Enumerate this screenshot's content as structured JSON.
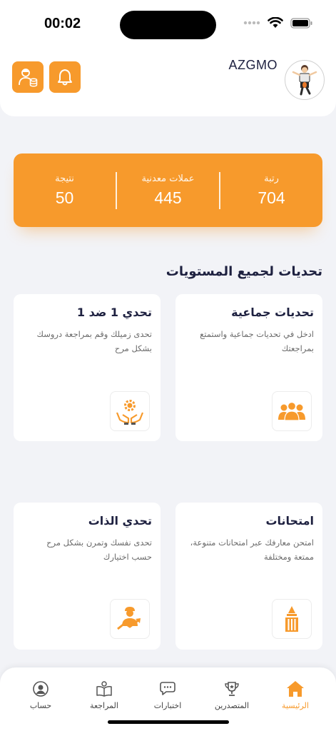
{
  "status_bar": {
    "time": "00:02"
  },
  "header": {
    "username": "AZGMO"
  },
  "stats": [
    {
      "label": "رتبة",
      "value": "704"
    },
    {
      "label": "عملات معدنية",
      "value": "445"
    },
    {
      "label": "نتيجة",
      "value": "50"
    }
  ],
  "section": {
    "title": "تحديات لجميع المستويات"
  },
  "cards": {
    "group": {
      "title": "تحديات جماعية",
      "desc": "ادخل في تحديات جماعية واستمتع بمراجعتك",
      "icon": "group-icon"
    },
    "duel": {
      "title": "تحدي 1 ضد 1",
      "desc": "تحدى زميلك وقم بمراجعة دروسك بشكل مرح",
      "icon": "gear-hands-icon"
    },
    "exams": {
      "title": "امتحانات",
      "desc": "امتحن معارفك عبر امتحانات متنوعة، ممتعة ومختلفة",
      "icon": "pencil-icon"
    },
    "self": {
      "title": "تحدي الذات",
      "desc": "تحدى نفسك وتمرن بشكل مرح حسب اختيارك",
      "icon": "person-growth-icon"
    }
  },
  "nav": [
    {
      "label": "الرئيسية",
      "icon": "home-icon",
      "active": true
    },
    {
      "label": "المتصدرين",
      "icon": "trophy-icon"
    },
    {
      "label": "اختبارات",
      "icon": "chat-icon"
    },
    {
      "label": "المراجعة",
      "icon": "book-icon"
    },
    {
      "label": "حساب",
      "icon": "user-icon"
    }
  ],
  "colors": {
    "accent": "#f79a2c",
    "background": "#f2f3f7",
    "title": "#1e2140"
  }
}
